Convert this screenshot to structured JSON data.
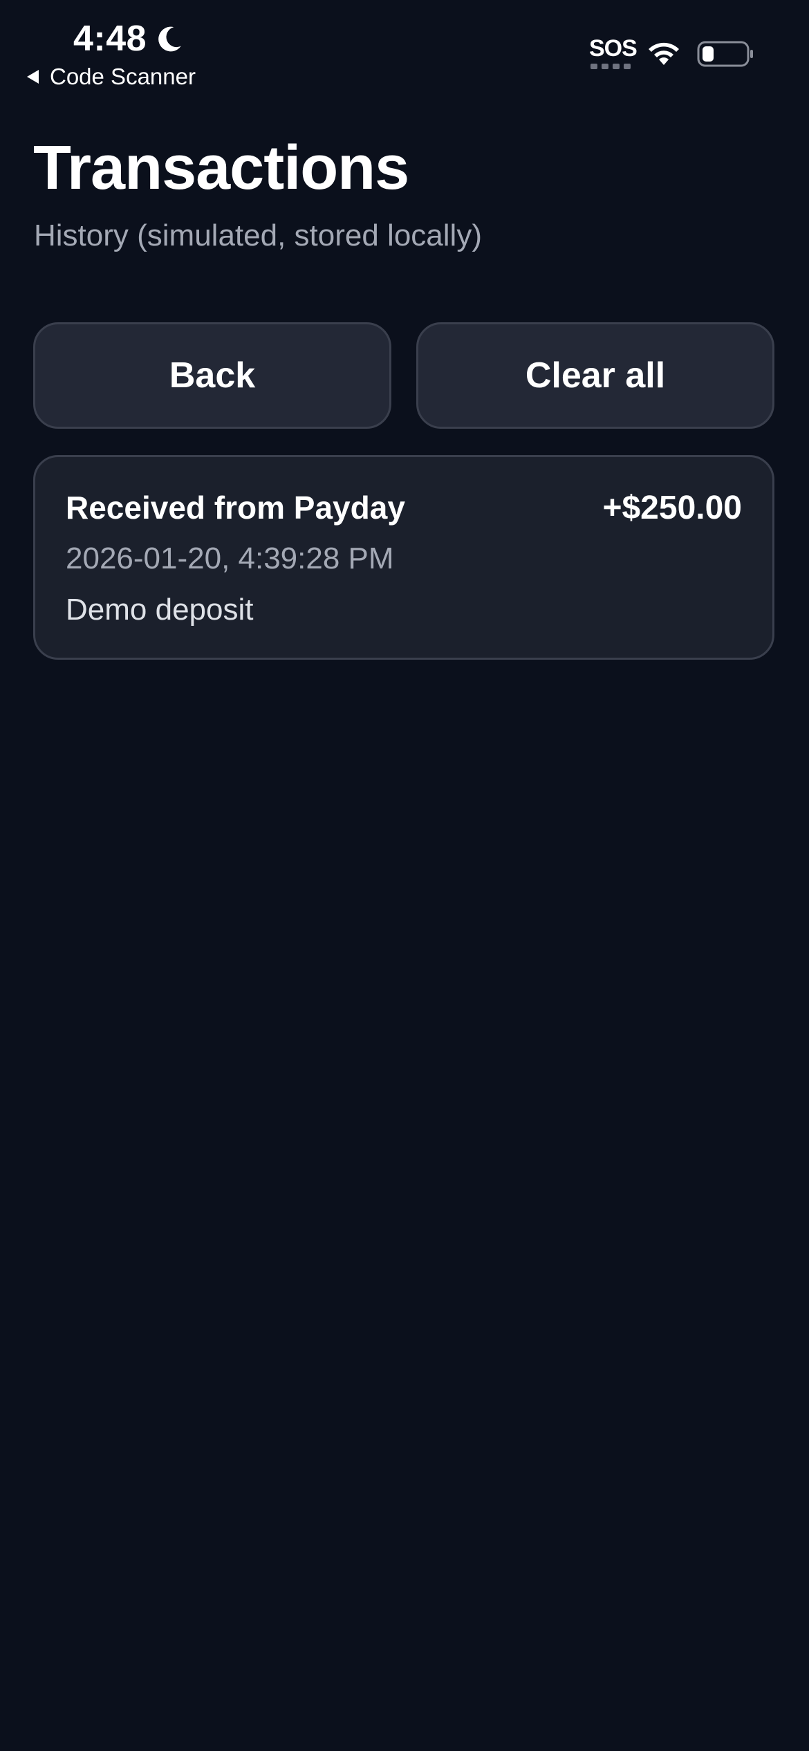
{
  "status_bar": {
    "time": "4:48",
    "back_app_label": "Code Scanner",
    "sos_label": "SOS",
    "icons": [
      "moon-icon",
      "wifi-icon",
      "battery-icon",
      "back-triangle-icon"
    ]
  },
  "header": {
    "title": "Transactions",
    "subtitle": "History (simulated, stored locally)"
  },
  "actions": {
    "back_label": "Back",
    "clear_label": "Clear all"
  },
  "transactions": [
    {
      "title": "Received from Payday",
      "amount": "+$250.00",
      "datetime": "2026-01-20, 4:39:28 PM",
      "note": "Demo deposit"
    }
  ],
  "colors": {
    "background": "#0b101c",
    "button_bg": "#232836",
    "card_bg": "#1b202c",
    "border": "#3a3f4d",
    "secondary_text": "#a4a9b5"
  }
}
